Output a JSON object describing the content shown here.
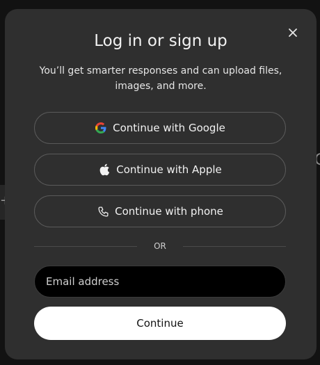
{
  "background": {
    "edge_text": "G",
    "edge_plus": "+"
  },
  "modal": {
    "title": "Log in or sign up",
    "subtitle": "You’ll get smarter responses and can upload files, images, and more.",
    "close_icon": "close-icon",
    "providers": [
      {
        "label": "Continue with Google",
        "icon": "google-icon"
      },
      {
        "label": "Continue with Apple",
        "icon": "apple-icon"
      },
      {
        "label": "Continue with phone",
        "icon": "phone-icon"
      }
    ],
    "divider_text": "OR",
    "email": {
      "placeholder": "Email address",
      "value": ""
    },
    "continue_label": "Continue"
  },
  "colors": {
    "modal_bg": "#2f2f2f",
    "button_border": "#5a5a5a",
    "primary_button_bg": "#ffffff",
    "input_bg": "#000000"
  }
}
